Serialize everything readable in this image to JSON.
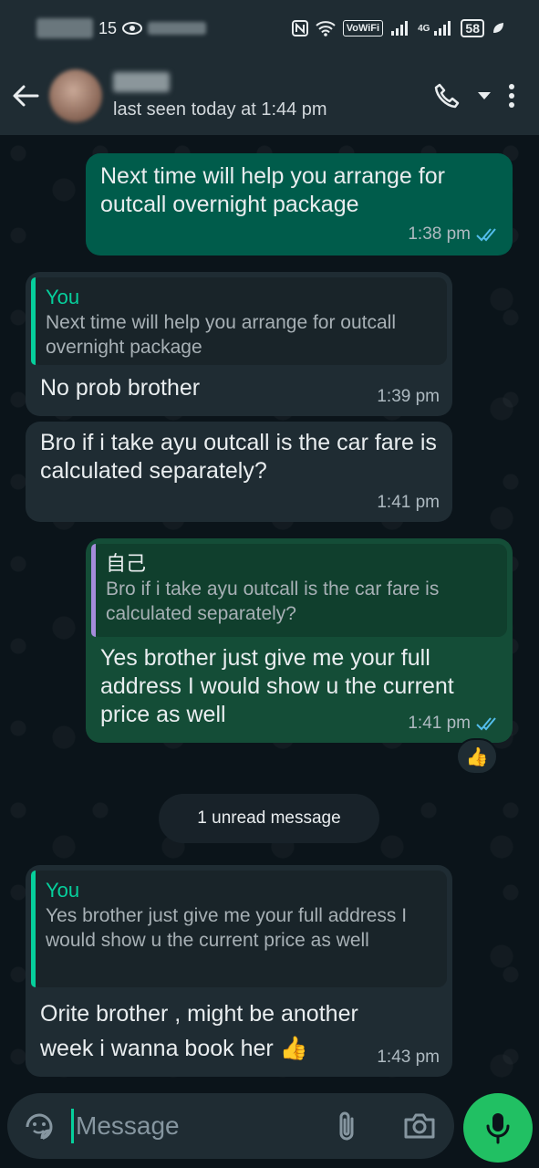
{
  "status_bar": {
    "time_partial": "15",
    "vowifi": "VoWiFi",
    "network": "4G",
    "battery": "58"
  },
  "header": {
    "last_seen": "last seen today at 1:44 pm"
  },
  "messages": [
    {
      "direction": "out",
      "text": "Next time will help you arrange for outcall overnight package",
      "time": "1:38 pm",
      "status": "read"
    },
    {
      "direction": "in",
      "quote_author": "You",
      "quote_text": "Next time will help you arrange for outcall overnight package",
      "text": "No prob brother",
      "time": "1:39 pm"
    },
    {
      "direction": "in",
      "text": "Bro if i take ayu outcall is the car fare is calculated separately?",
      "time": "1:41 pm"
    },
    {
      "direction": "out",
      "quote_author": "自己",
      "quote_text": "Bro if i take ayu outcall is the car fare is calculated separately?",
      "text": "Yes brother just give me your full address I would show u the current price as well",
      "time": "1:41 pm",
      "status": "read",
      "reaction": "👍"
    },
    {
      "direction": "in",
      "quote_author": "You",
      "quote_text": "Yes brother just give me your full address I would show u the current price as well",
      "text": "Orite brother , might be another week i wanna book her 👍",
      "time": "1:43 pm"
    }
  ],
  "unread_divider": "1 unread message",
  "composer": {
    "placeholder": "Message"
  },
  "colors": {
    "header_bg": "#1f2c33",
    "outgoing_bubble": "#005c4b",
    "incoming_bubble": "#1f2c33",
    "accent": "#21c063",
    "quote_you": "#06cf9c",
    "quote_self": "#a58cdc"
  },
  "icons": [
    "back-arrow-icon",
    "phone-icon",
    "dropdown-icon",
    "more-vert-icon",
    "sticker-icon",
    "attach-icon",
    "camera-icon",
    "mic-icon",
    "double-check-icon",
    "thumbs-up-reaction-icon"
  ]
}
